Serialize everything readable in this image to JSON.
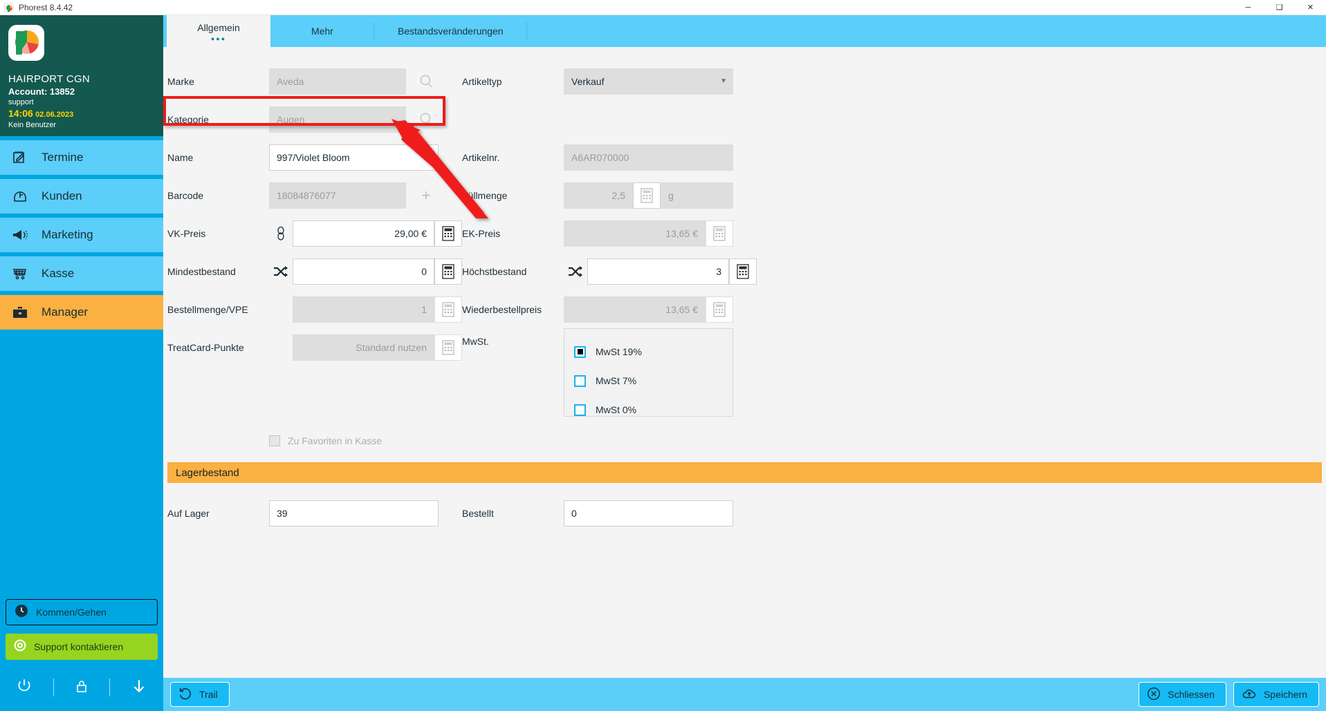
{
  "window": {
    "title": "Phorest 8.4.42",
    "app_icon": "phorest-logo-icon",
    "minimize": "─",
    "maximize": "❑",
    "close": "✕"
  },
  "sidebar": {
    "salon_name": "HAIRPORT CGN",
    "account_label": "Account: 13852",
    "support_label": "support",
    "time": "14:06",
    "date": "02.06.2023",
    "user": "Kein Benutzer",
    "items": [
      {
        "label": "Termine",
        "icon": "calendar-edit-icon",
        "active": false
      },
      {
        "label": "Kunden",
        "icon": "client-head-icon",
        "active": false
      },
      {
        "label": "Marketing",
        "icon": "megaphone-icon",
        "active": false
      },
      {
        "label": "Kasse",
        "icon": "shopping-cart-icon",
        "active": false
      },
      {
        "label": "Manager",
        "icon": "briefcase-icon",
        "active": true
      }
    ],
    "clock_button": {
      "label": "Kommen/Gehen",
      "icon": "clock-icon"
    },
    "support_button": {
      "label": "Support kontaktieren",
      "icon": "lifebuoy-icon"
    },
    "footer_icons": [
      "power-icon",
      "lock-icon",
      "download-arrow-icon"
    ]
  },
  "tabs": [
    {
      "label": "Allgemein",
      "active": true,
      "dots": "●●●"
    },
    {
      "label": "Mehr",
      "active": false
    },
    {
      "label": "Bestandsveränderungen",
      "active": false
    }
  ],
  "form": {
    "marke": {
      "label": "Marke",
      "value": "Aveda",
      "disabled": true,
      "icon": "search-icon"
    },
    "artikeltyp": {
      "label": "Artikeltyp",
      "value": "Verkauf",
      "caret": "▼"
    },
    "kategorie": {
      "label": "Kategorie",
      "value": "Augen",
      "disabled": true,
      "icon": "search-icon",
      "highlighted": true
    },
    "name": {
      "label": "Name",
      "value": "997/Violet Bloom",
      "disabled": false
    },
    "artikelnr": {
      "label": "Artikelnr.",
      "value": "A6AR070000",
      "disabled": true
    },
    "barcode": {
      "label": "Barcode",
      "value": "18084876077",
      "disabled": true,
      "add_icon": "plus-icon"
    },
    "fuellmenge": {
      "label": "Füllmenge",
      "value": "2,5",
      "unit": "g",
      "disabled": true,
      "icon": "calculator-icon"
    },
    "vk_preis": {
      "label": "VK-Preis",
      "value": "29,00 €",
      "disabled": false,
      "pre_icon": "link-chain-icon",
      "icon": "calculator-icon"
    },
    "ek_preis": {
      "label": "EK-Preis",
      "value": "13,65 €",
      "disabled": true,
      "icon": "calculator-icon"
    },
    "mindestbestand": {
      "label": "Mindestbestand",
      "value": "0",
      "disabled": false,
      "pre_icon": "shuffle-arrows-icon",
      "icon": "calculator-icon"
    },
    "hoechstbestand": {
      "label": "Höchstbestand",
      "value": "3",
      "disabled": false,
      "pre_icon": "shuffle-arrows-icon",
      "icon": "calculator-icon"
    },
    "bestellmenge": {
      "label": "Bestellmenge/VPE",
      "value": "1",
      "disabled": true,
      "icon": "calculator-icon"
    },
    "wiederbestellpreis": {
      "label": "Wiederbestellpreis",
      "value": "13,65 €",
      "disabled": true,
      "icon": "calculator-icon"
    },
    "treatcard": {
      "label": "TreatCard-Punkte",
      "value": "Standard nutzen",
      "disabled": true,
      "icon": "calculator-icon"
    },
    "favoriten": {
      "label": "Zu Favoriten in Kasse",
      "checked": false
    },
    "mwst": {
      "label": "MwSt.",
      "options": [
        {
          "label": "MwSt 19%",
          "checked": true
        },
        {
          "label": "MwSt 7%",
          "checked": false
        },
        {
          "label": "MwSt 0%",
          "checked": false
        }
      ]
    }
  },
  "stock_section": {
    "title": "Lagerbestand",
    "auf_lager": {
      "label": "Auf Lager",
      "value": "39"
    },
    "bestellt": {
      "label": "Bestellt",
      "value": "0"
    }
  },
  "bottom_bar": {
    "trail": {
      "label": "Trail",
      "icon": "undo-circle-icon"
    },
    "schliessen": {
      "label": "Schliessen",
      "icon": "close-circle-icon"
    },
    "speichern": {
      "label": "Speichern",
      "icon": "cloud-upload-icon"
    }
  },
  "annotation": {
    "highlight_color": "#ef1b1b",
    "target": "kategorie-field"
  },
  "colors": {
    "brand_teal": "#14594f",
    "sidebar_blue": "#00a6e2",
    "nav_blue": "#5bcefa",
    "accent_orange": "#fbb042",
    "support_green": "#95d41f",
    "time_yellow": "#ffd400"
  }
}
